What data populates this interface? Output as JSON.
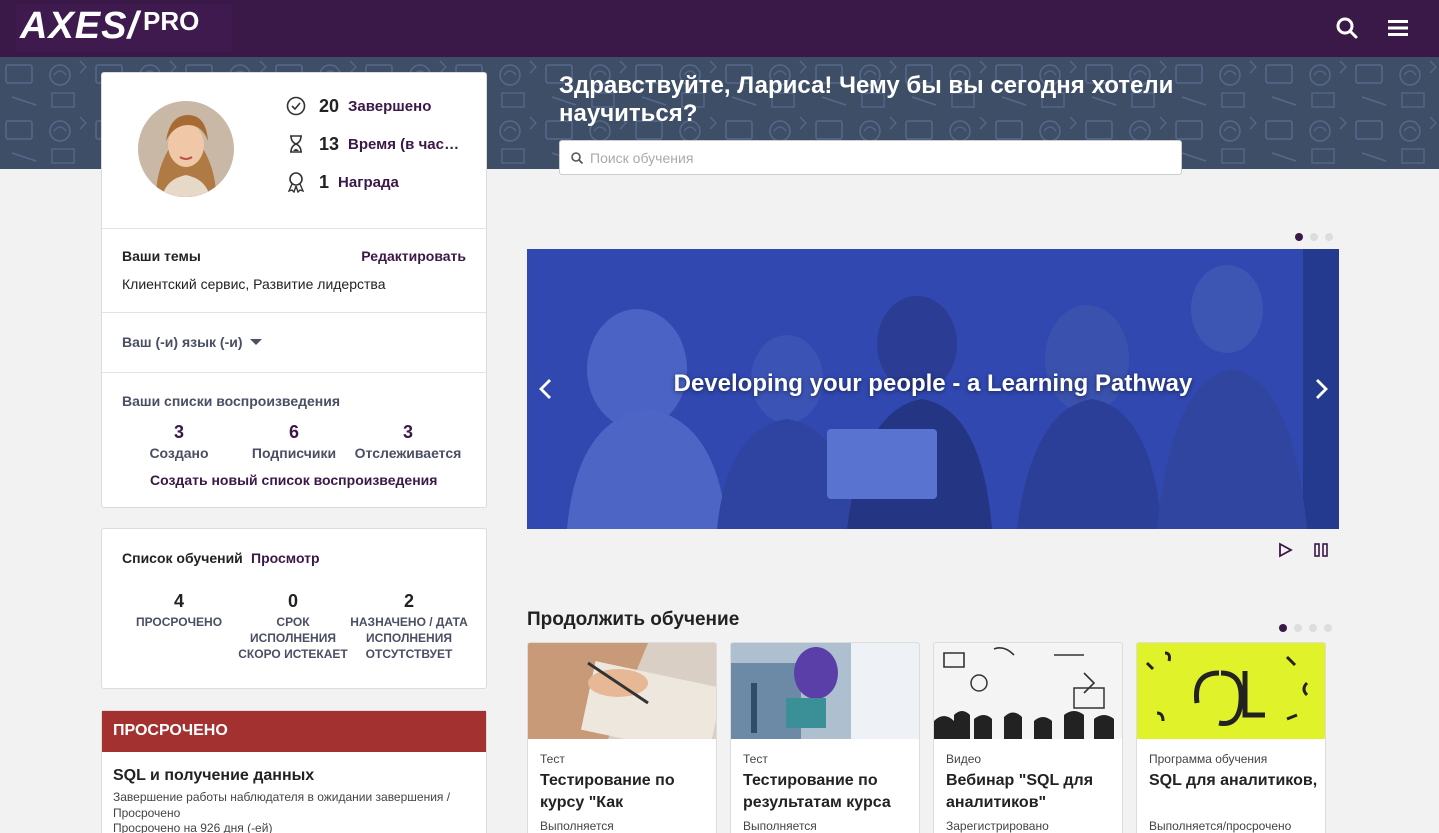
{
  "header": {
    "logo_main": "AXES/",
    "logo_pro": "PRO",
    "search_icon": "search-icon",
    "menu_icon": "hamburger-menu-icon"
  },
  "hero": {
    "greeting": "Здравствуйте, Лариса! Чему бы вы сегодня хотели научиться?",
    "search_placeholder": "Поиск обучения"
  },
  "profile": {
    "stats": [
      {
        "icon": "checkmark-circle-icon",
        "value": "20",
        "label": "Завершено"
      },
      {
        "icon": "hourglass-icon",
        "value": "13",
        "label": "Время (в часах)"
      },
      {
        "icon": "award-ribbon-icon",
        "value": "1",
        "label": "Награда"
      }
    ],
    "topics_title": "Ваши темы",
    "edit_label": "Редактировать",
    "topics_value": "Клиентский сервис, Развитие лидерства",
    "language_label": "Ваш (-и) язык (-и)",
    "playlists_title": "Ваши списки воспроизведения",
    "playlists": [
      {
        "value": "3",
        "label": "Создано"
      },
      {
        "value": "6",
        "label": "Подписчики"
      },
      {
        "value": "3",
        "label": "Отслеживается"
      }
    ],
    "create_playlist": "Создать новый список воспроизведения"
  },
  "learning_list": {
    "title": "Список обучений",
    "view_label": "Просмотр",
    "items": [
      {
        "value": "4",
        "label": "ПРОСРОЧЕНО"
      },
      {
        "value": "0",
        "label": "СРОК ИСПОЛНЕНИЯ СКОРО ИСТЕКАЕТ"
      },
      {
        "value": "2",
        "label": "НАЗНАЧЕНО / ДАТА ИСПОЛНЕНИЯ ОТСУТСТВУЕТ"
      }
    ]
  },
  "overdue": {
    "header": "ПРОСРОЧЕНО",
    "title": "SQL и получение данных",
    "subtitle": "Завершение работы наблюдателя в ожидании завершения / Просрочено",
    "detail": "Просрочено на 926 дня (-ей)"
  },
  "carousel": {
    "caption": "Developing your people - a Learning Pathway",
    "slide_count": 3,
    "active_slide": 1
  },
  "continue": {
    "title": "Продолжить обучение",
    "tiles": [
      {
        "type": "Тест",
        "name": "Тестирование по курсу \"Как",
        "status": "Выполняется"
      },
      {
        "type": "Тест",
        "name": "Тестирование по результатам курса",
        "status": "Выполняется"
      },
      {
        "type": "Видео",
        "name": "Вебинар \"SQL для аналитиков\"",
        "status": "Зарегистрировано"
      },
      {
        "type": "Программа обучения",
        "name": "SQL для аналитиков,",
        "status": "Выполняется/просрочено"
      }
    ],
    "page_count": 4,
    "active_page": 1
  },
  "colors": {
    "brand": "#3a1848",
    "overdue": "#a3312f",
    "carousel": "#2a3fa8"
  }
}
